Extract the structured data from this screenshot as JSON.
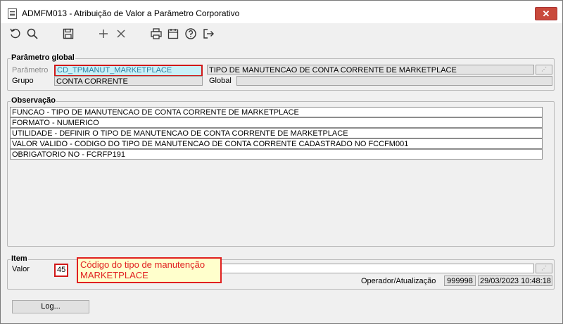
{
  "window": {
    "title": "ADMFM013 - Atribuição de Valor a Parâmetro Corporativo",
    "close_label": "✕"
  },
  "toolbar": {
    "icons": [
      "undo-icon",
      "search-icon",
      "save-icon",
      "add-icon",
      "delete-icon",
      "print-icon",
      "calendar-icon",
      "help-icon",
      "exit-icon"
    ]
  },
  "parametro_global": {
    "legend": "Parâmetro global",
    "parametro_label": "Parâmetro",
    "parametro_value": "CD_TPMANUT_MARKETPLACE",
    "descricao_value": "TIPO DE MANUTENCAO DE CONTA CORRENTE DE MARKETPLACE",
    "grupo_label": "Grupo",
    "grupo_value": "CONTA CORRENTE",
    "global_label": "Global",
    "global_value": ""
  },
  "observacao": {
    "legend": "Observação",
    "lines": [
      "FUNCAO - TIPO DE MANUTENCAO DE CONTA CORRENTE DE MARKETPLACE",
      "FORMATO - NUMERICO",
      "UTILIDADE - DEFINIR O TIPO DE MANUTENCAO DE CONTA CORRENTE DE MARKETPLACE",
      "VALOR VALIDO - CODIGO DO TIPO DE MANUTENCAO DE CONTA CORRENTE CADASTRADO NO FCCFM001",
      "OBRIGATORIO NO - FCRFP191"
    ]
  },
  "item": {
    "legend": "Item",
    "valor_label": "Valor",
    "valor_value": "45",
    "annotation_line1": "Código do tipo de manutenção",
    "annotation_line2": "MARKETPLACE",
    "operador_label": "Operador/Atualização",
    "operador_value": "999998",
    "atualizacao_value": "29/03/2023 10:48:18"
  },
  "footer": {
    "log_button": "Log..."
  },
  "colors": {
    "highlight_field": "#c8f0f8",
    "annotation_border": "#e02020",
    "annotation_bg": "#ffffcc"
  }
}
